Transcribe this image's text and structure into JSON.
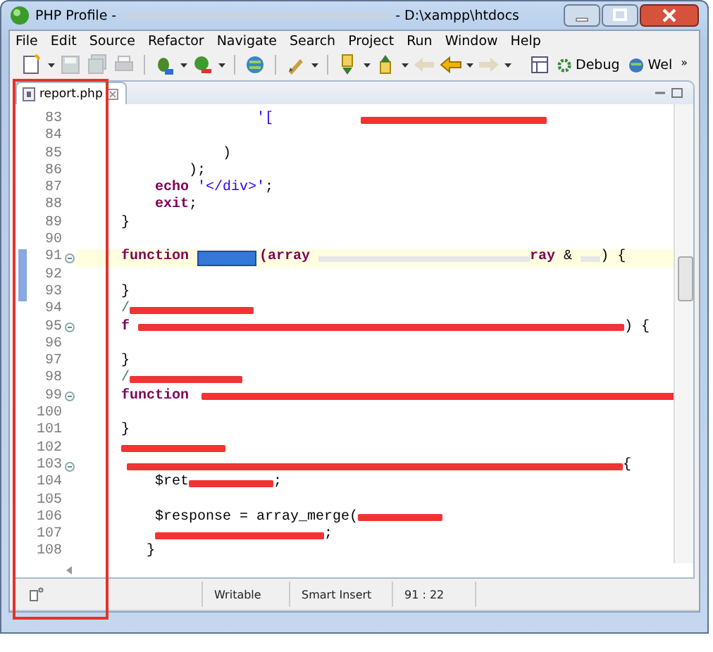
{
  "window": {
    "title_start": "PHP Profile -",
    "title_end": "- D:\\xampp\\htdocs"
  },
  "menu": [
    "File",
    "Edit",
    "Source",
    "Refactor",
    "Navigate",
    "Search",
    "Project",
    "Run",
    "Window",
    "Help"
  ],
  "toolbar": {
    "buttons": [
      {
        "kind": "new",
        "disabled": false
      },
      {
        "kind": "save",
        "disabled": true
      },
      {
        "kind": "save-all",
        "disabled": true
      },
      {
        "kind": "print",
        "disabled": true
      },
      {
        "kind": "debug",
        "disabled": false
      },
      {
        "kind": "run",
        "disabled": false
      },
      {
        "kind": "globe",
        "disabled": false
      },
      {
        "kind": "pen",
        "disabled": false
      },
      {
        "kind": "annotation-down",
        "disabled": false
      },
      {
        "kind": "annotation-up",
        "disabled": false
      },
      {
        "kind": "back",
        "disabled": true
      },
      {
        "kind": "back-yellow",
        "disabled": false
      },
      {
        "kind": "forward",
        "disabled": true
      }
    ],
    "perspectives": [
      {
        "label": "Debug"
      },
      {
        "label": "Wel"
      }
    ],
    "overflow": "»"
  },
  "tabs": [
    {
      "label": "report.php",
      "selected": true
    }
  ],
  "editor": {
    "lines": [
      {
        "number": "83",
        "segments": [
          {
            "kind": "string",
            "text": "'["
          },
          {
            "kind": "redacted"
          }
        ]
      },
      {
        "number": "84"
      },
      {
        "number": "85",
        "segments": [
          {
            "kind": "plain",
            "text": ")"
          }
        ]
      },
      {
        "number": "86",
        "segments": [
          {
            "kind": "plain",
            "text": ");"
          }
        ]
      },
      {
        "number": "87",
        "segments": [
          {
            "kind": "keyword",
            "text": "echo"
          },
          {
            "kind": "string",
            "text": " '</div>'"
          },
          {
            "kind": "plain",
            "text": ";"
          }
        ]
      },
      {
        "number": "88",
        "segments": [
          {
            "kind": "keyword",
            "text": "exit"
          },
          {
            "kind": "plain",
            "text": ";"
          }
        ]
      },
      {
        "number": "89",
        "segments": [
          {
            "kind": "plain",
            "text": "}"
          }
        ]
      },
      {
        "number": "90"
      },
      {
        "number": "91",
        "current": true,
        "foldable": true,
        "range_marked": true,
        "segments": [
          {
            "kind": "keyword",
            "text": "function"
          },
          {
            "kind": "selection"
          },
          {
            "kind": "keyword",
            "text": "(array"
          },
          {
            "kind": "blurred"
          },
          {
            "kind": "keyword",
            "text": "ray"
          },
          {
            "kind": "plain",
            "text": " &"
          },
          {
            "kind": "blurred"
          },
          {
            "kind": "plain",
            "text": ") {"
          }
        ]
      },
      {
        "number": "92",
        "range_marked": true
      },
      {
        "number": "93",
        "range_marked": true,
        "segments": [
          {
            "kind": "plain",
            "text": "}"
          }
        ]
      },
      {
        "number": "94",
        "segments": [
          {
            "kind": "comment",
            "text": "/"
          },
          {
            "kind": "redacted"
          }
        ]
      },
      {
        "number": "95",
        "foldable": true,
        "segments": [
          {
            "kind": "keyword",
            "text": "f"
          },
          {
            "kind": "redacted"
          },
          {
            "kind": "plain",
            "text": ") {"
          }
        ]
      },
      {
        "number": "96"
      },
      {
        "number": "97",
        "segments": [
          {
            "kind": "plain",
            "text": "}"
          }
        ]
      },
      {
        "number": "98",
        "segments": [
          {
            "kind": "comment",
            "text": "/"
          },
          {
            "kind": "redacted"
          }
        ]
      },
      {
        "number": "99",
        "foldable": true,
        "segments": [
          {
            "kind": "keyword",
            "text": "function"
          },
          {
            "kind": "redacted"
          }
        ]
      },
      {
        "number": "100"
      },
      {
        "number": "101",
        "segments": [
          {
            "kind": "plain",
            "text": "}"
          }
        ]
      },
      {
        "number": "102",
        "segments": [
          {
            "kind": "redacted"
          }
        ]
      },
      {
        "number": "103",
        "foldable": true,
        "segments": [
          {
            "kind": "redacted"
          },
          {
            "kind": "plain",
            "text": "{"
          }
        ]
      },
      {
        "number": "104",
        "segments": [
          {
            "kind": "plain",
            "text": "$ret"
          },
          {
            "kind": "redacted"
          },
          {
            "kind": "plain",
            "text": ";"
          }
        ]
      },
      {
        "number": "105"
      },
      {
        "number": "106",
        "segments": [
          {
            "kind": "plain",
            "text": "$response = array_merge("
          },
          {
            "kind": "redacted"
          }
        ]
      },
      {
        "number": "107",
        "segments": [
          {
            "kind": "redacted"
          },
          {
            "kind": "plain",
            "text": ";"
          }
        ]
      },
      {
        "number": "108",
        "segments": [
          {
            "kind": "plain",
            "text": "}"
          }
        ]
      }
    ]
  },
  "status_bar": {
    "mode": "Writable",
    "insert": "Smart Insert",
    "position": "91 : 22"
  },
  "annotation_frame": true
}
